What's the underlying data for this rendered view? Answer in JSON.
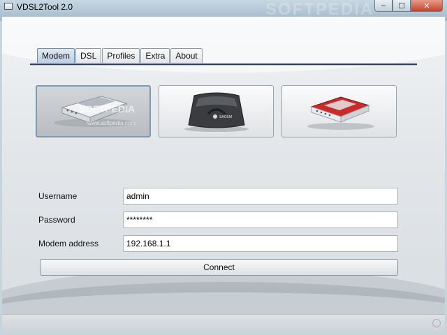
{
  "window": {
    "title": "VDSL2Tool 2.0",
    "watermark": "SOFTPEDIA",
    "controls": {
      "minimize": "–",
      "maximize": "☐",
      "close": "✕"
    }
  },
  "tabs": [
    {
      "label": "Modem",
      "active": true
    },
    {
      "label": "DSL"
    },
    {
      "label": "Profiles"
    },
    {
      "label": "Extra"
    },
    {
      "label": "About"
    }
  ],
  "devices": [
    {
      "name": "white-modem",
      "selected": true,
      "watermark": "SOFTPEDIA",
      "watermark_url": "www.softpedia.com"
    },
    {
      "name": "sagem-modem",
      "selected": false,
      "brand": "SAGEM"
    },
    {
      "name": "red-router",
      "selected": false
    }
  ],
  "form": {
    "username_label": "Username",
    "username_value": "admin",
    "password_label": "Password",
    "password_value": "********",
    "modem_address_label": "Modem address",
    "modem_address_value": "192.168.1.1",
    "connect_label": "Connect"
  },
  "colors": {
    "tab_active": "#bcd0e2",
    "tab_underline": "#2f3d58",
    "close_button": "#c6432b"
  }
}
